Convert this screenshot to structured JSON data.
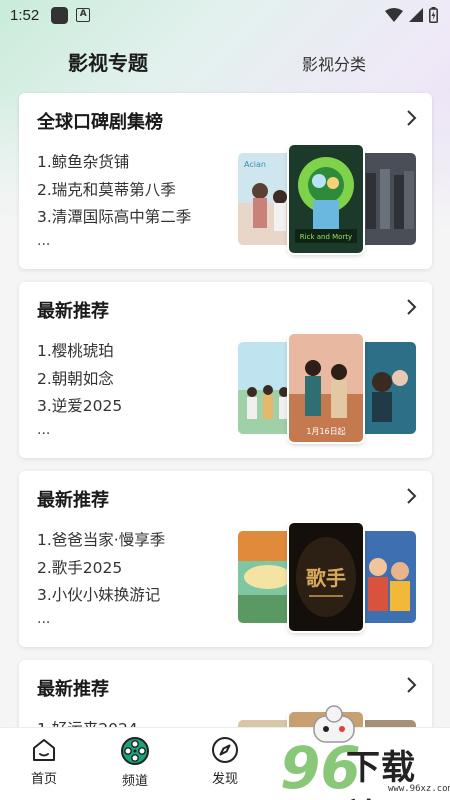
{
  "status_bar": {
    "time": "1:52",
    "badge_letter": "A"
  },
  "tabs": [
    {
      "label": "影视专题",
      "active": true
    },
    {
      "label": "影视分类",
      "active": false
    }
  ],
  "cards": [
    {
      "title": "全球口碑剧集榜",
      "items": [
        "1.鲸鱼杂货铺",
        "2.瑞克和莫蒂第八季",
        "3.清潭国际高中第二季"
      ],
      "more": "...",
      "poster_labels": [
        "Rick and Morty"
      ]
    },
    {
      "title": "最新推荐",
      "items": [
        "1.樱桃琥珀",
        "2.朝朝如念",
        "3.逆爱2025"
      ],
      "more": "...",
      "poster_labels": [
        "1月16日起"
      ]
    },
    {
      "title": "最新推荐",
      "items": [
        "1.爸爸当家·慢享季",
        "2.歌手2025",
        "3.小伙小妹换游记"
      ],
      "more": "...",
      "poster_labels": [
        "歌手"
      ]
    },
    {
      "title": "最新推荐",
      "items": [
        "1.好运来2024"
      ],
      "more": "",
      "poster_labels": []
    }
  ],
  "bottom_nav": [
    {
      "label": "首页",
      "icon": "home-icon"
    },
    {
      "label": "频道",
      "icon": "film-reel-icon"
    },
    {
      "label": "发现",
      "icon": "compass-icon"
    }
  ],
  "watermark": {
    "number": "96",
    "text": "下载站",
    "url": "www.96xz.com"
  },
  "colors": {
    "page_bg": "#f5f5f5",
    "gradient_green": "#c9ecd9",
    "gradient_purple": "#e7ddf5",
    "reel_accent": "#1aa37a"
  }
}
